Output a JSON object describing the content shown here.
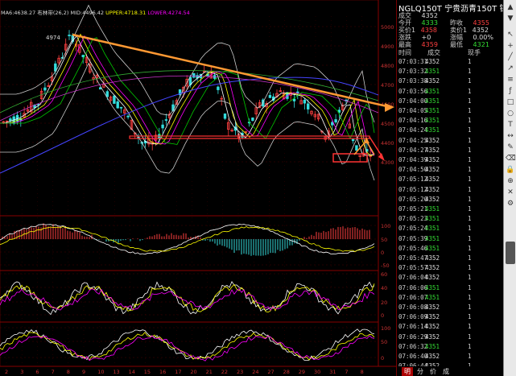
{
  "header": {
    "symbol": "NGLQ150T",
    "name": "宁贵沥青150T",
    "market": "银汇"
  },
  "indicator_line": {
    "ma": "MA6:4638.27",
    "boll_label": "布林带",
    "boll_params": "(26,2)",
    "mid": "MID:4496.42",
    "upper": "UPPER:4718.31",
    "lower": "LOWER:4274.54"
  },
  "high_marker": "4974",
  "quote": {
    "r1": {
      "l1": "成交",
      "v1": "4352"
    },
    "r2": {
      "l1": "今开",
      "v1": "4333",
      "l2": "昨收",
      "v2": "4355"
    },
    "r3": {
      "l1": "买价1",
      "v1": "4358",
      "l2": "卖价1",
      "v2": "4352"
    },
    "r4": {
      "l1": "涨跌",
      "v1": "+0",
      "l2": "涨幅",
      "v2": "0.00%"
    },
    "r5": {
      "l1": "最高",
      "v1": "4359",
      "l2": "最低",
      "v2": "4321"
    }
  },
  "ticks_header": {
    "time": "时间",
    "price": "成交",
    "vol": "现手"
  },
  "ticks": [
    {
      "time": "07:03:31",
      "price": "4352",
      "vol": "1",
      "dir": "wh"
    },
    {
      "time": "07:03:32",
      "price": "4351",
      "vol": "1",
      "dir": "dn"
    },
    {
      "time": "07:03:38",
      "price": "4352",
      "vol": "1",
      "dir": "wh"
    },
    {
      "time": "07:03:56",
      "price": "4351",
      "vol": "1",
      "dir": "dn"
    },
    {
      "time": "07:04:00",
      "price": "4351",
      "vol": "1",
      "dir": "dn"
    },
    {
      "time": "07:04:05",
      "price": "4351",
      "vol": "1",
      "dir": "dn"
    },
    {
      "time": "07:04:16",
      "price": "4351",
      "vol": "1",
      "dir": "dn"
    },
    {
      "time": "07:04:24",
      "price": "4351",
      "vol": "1",
      "dir": "dn"
    },
    {
      "time": "07:04:25",
      "price": "4352",
      "vol": "1",
      "dir": "wh"
    },
    {
      "time": "07:04:27",
      "price": "4352",
      "vol": "1",
      "dir": "wh"
    },
    {
      "time": "07:04:39",
      "price": "4352",
      "vol": "1",
      "dir": "wh"
    },
    {
      "time": "07:04:50",
      "price": "4352",
      "vol": "1",
      "dir": "wh"
    },
    {
      "time": "07:05:12",
      "price": "4352",
      "vol": "1",
      "dir": "wh"
    },
    {
      "time": "07:05:12",
      "price": "4352",
      "vol": "1",
      "dir": "wh"
    },
    {
      "time": "07:05:20",
      "price": "4352",
      "vol": "1",
      "dir": "wh"
    },
    {
      "time": "07:05:21",
      "price": "4351",
      "vol": "1",
      "dir": "dn"
    },
    {
      "time": "07:05:23",
      "price": "4351",
      "vol": "1",
      "dir": "dn"
    },
    {
      "time": "07:05:24",
      "price": "4351",
      "vol": "1",
      "dir": "dn"
    },
    {
      "time": "07:05:39",
      "price": "4351",
      "vol": "1",
      "dir": "dn"
    },
    {
      "time": "07:05:46",
      "price": "4351",
      "vol": "1",
      "dir": "dn"
    },
    {
      "time": "07:05:47",
      "price": "4352",
      "vol": "1",
      "dir": "wh"
    },
    {
      "time": "07:05:57",
      "price": "4352",
      "vol": "1",
      "dir": "wh"
    },
    {
      "time": "07:06:04",
      "price": "4352",
      "vol": "1",
      "dir": "wh"
    },
    {
      "time": "07:06:06",
      "price": "4351",
      "vol": "1",
      "dir": "dn"
    },
    {
      "time": "07:06:07",
      "price": "4351",
      "vol": "1",
      "dir": "dn"
    },
    {
      "time": "07:06:08",
      "price": "4352",
      "vol": "1",
      "dir": "wh"
    },
    {
      "time": "07:06:09",
      "price": "4352",
      "vol": "1",
      "dir": "wh"
    },
    {
      "time": "07:06:14",
      "price": "4352",
      "vol": "1",
      "dir": "wh"
    },
    {
      "time": "07:06:29",
      "price": "4352",
      "vol": "1",
      "dir": "wh"
    },
    {
      "time": "07:06:32",
      "price": "4351",
      "vol": "1",
      "dir": "dn"
    },
    {
      "time": "07:06:40",
      "price": "4352",
      "vol": "1",
      "dir": "wh"
    },
    {
      "time": "07:06:44",
      "price": "4352",
      "vol": "1",
      "dir": "wh"
    }
  ],
  "bottom_tabs": [
    "明",
    "分",
    "价",
    "成"
  ],
  "price_axis": [
    "5000",
    "4900",
    "4800",
    "4700",
    "4600",
    "4500",
    "4400",
    "4300"
  ],
  "macd_axis": [
    "100",
    "50",
    "0",
    "-50"
  ],
  "kd_axis": [
    "60",
    "40",
    "20",
    "0"
  ],
  "rsi_axis": [
    "100",
    "50",
    "0"
  ],
  "x_axis": [
    "2",
    "3",
    "6",
    "7",
    "8",
    "9",
    "10",
    "13",
    "14",
    "15",
    "16",
    "17",
    "20",
    "21",
    "22",
    "23",
    "24",
    "27",
    "28",
    "29",
    "30",
    "31",
    "7",
    "8"
  ],
  "toolbar_icons": [
    "arrow-up-icon",
    "arrow-down-icon",
    "pointer-icon",
    "plus-icon",
    "line-icon",
    "trend-icon",
    "channel-icon",
    "fib-icon",
    "rect-icon",
    "ellipse-icon",
    "text-icon",
    "measure-icon",
    "brush-icon",
    "eraser-icon",
    "lock-icon",
    "magnet-icon",
    "trash-icon",
    "settings-icon"
  ],
  "colors": {
    "up": "#ff4040",
    "down": "#33dd33",
    "trend": "#ff9933",
    "support": "#ff3333",
    "grid": "#4a0000"
  }
}
